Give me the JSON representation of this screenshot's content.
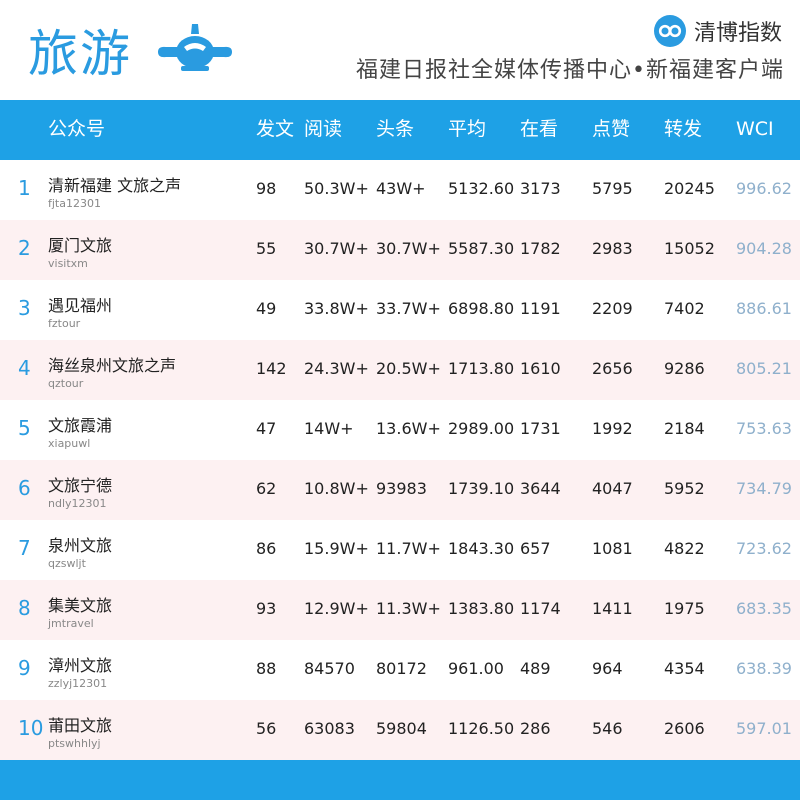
{
  "header": {
    "title": "旅游",
    "brand_name": "清博指数",
    "subtitle": "福建日报社全媒体传播中心•新福建客户端",
    "icons": [
      "airplane-icon",
      "qingbo-logo-icon"
    ]
  },
  "colors": {
    "accent": "#1ea1e6",
    "title": "#2a9be0",
    "row_alt": "#fdf1f2",
    "wci": "#8fb0cc"
  },
  "chart_data": {
    "type": "table",
    "columns": [
      "公众号",
      "发文",
      "阅读",
      "头条",
      "平均",
      "在看",
      "点赞",
      "转发",
      "WCI"
    ],
    "rows": [
      {
        "rank": "1",
        "name": "清新福建 文旅之声",
        "account": "fjta12301",
        "posts": "98",
        "reads": "50.3W+",
        "headline": "43W+",
        "average": "5132.60",
        "watching": "3173",
        "likes": "5795",
        "shares": "20245",
        "wci": "996.62"
      },
      {
        "rank": "2",
        "name": "厦门文旅",
        "account": "visitxm",
        "posts": "55",
        "reads": "30.7W+",
        "headline": "30.7W+",
        "average": "5587.30",
        "watching": "1782",
        "likes": "2983",
        "shares": "15052",
        "wci": "904.28"
      },
      {
        "rank": "3",
        "name": "遇见福州",
        "account": "fztour",
        "posts": "49",
        "reads": "33.8W+",
        "headline": "33.7W+",
        "average": "6898.80",
        "watching": "1191",
        "likes": "2209",
        "shares": "7402",
        "wci": "886.61"
      },
      {
        "rank": "4",
        "name": "海丝泉州文旅之声",
        "account": "qztour",
        "posts": "142",
        "reads": "24.3W+",
        "headline": "20.5W+",
        "average": "1713.80",
        "watching": "1610",
        "likes": "2656",
        "shares": "9286",
        "wci": "805.21"
      },
      {
        "rank": "5",
        "name": "文旅霞浦",
        "account": "xiapuwl",
        "posts": "47",
        "reads": "14W+",
        "headline": "13.6W+",
        "average": "2989.00",
        "watching": "1731",
        "likes": "1992",
        "shares": "2184",
        "wci": "753.63"
      },
      {
        "rank": "6",
        "name": "文旅宁德",
        "account": "ndly12301",
        "posts": "62",
        "reads": "10.8W+",
        "headline": "93983",
        "average": "1739.10",
        "watching": "3644",
        "likes": "4047",
        "shares": "5952",
        "wci": "734.79"
      },
      {
        "rank": "7",
        "name": "泉州文旅",
        "account": "qzswljt",
        "posts": "86",
        "reads": "15.9W+",
        "headline": "11.7W+",
        "average": "1843.30",
        "watching": "657",
        "likes": "1081",
        "shares": "4822",
        "wci": "723.62"
      },
      {
        "rank": "8",
        "name": "集美文旅",
        "account": "jmtravel",
        "posts": "93",
        "reads": "12.9W+",
        "headline": "11.3W+",
        "average": "1383.80",
        "watching": "1174",
        "likes": "1411",
        "shares": "1975",
        "wci": "683.35"
      },
      {
        "rank": "9",
        "name": "漳州文旅",
        "account": "zzlyj12301",
        "posts": "88",
        "reads": "84570",
        "headline": "80172",
        "average": "961.00",
        "watching": "489",
        "likes": "964",
        "shares": "4354",
        "wci": "638.39"
      },
      {
        "rank": "10",
        "name": "莆田文旅",
        "account": "ptswhhlyj",
        "posts": "56",
        "reads": "63083",
        "headline": "59804",
        "average": "1126.50",
        "watching": "286",
        "likes": "546",
        "shares": "2606",
        "wci": "597.01"
      }
    ]
  }
}
